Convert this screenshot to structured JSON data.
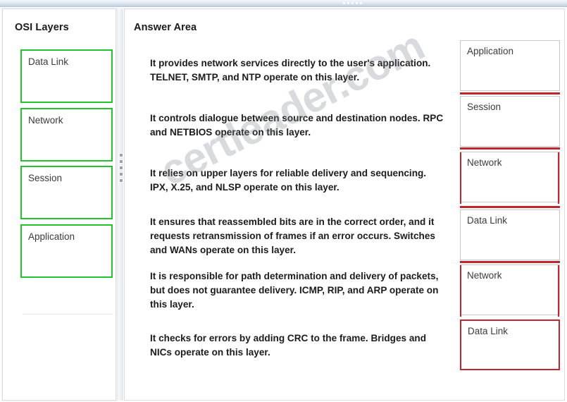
{
  "window": {
    "splitter_handle": "horizontal-splitter-handle",
    "vertical_splitter_handle": "vertical-splitter-handle"
  },
  "left_panel": {
    "title": "OSI Layers",
    "tiles": [
      {
        "label": "Data Link"
      },
      {
        "label": "Network"
      },
      {
        "label": "Session"
      },
      {
        "label": "Application"
      }
    ]
  },
  "answer_area": {
    "title": "Answer Area",
    "statements": [
      "It provides network services directly to the user's application. TELNET, SMTP, and NTP operate on this layer.",
      "It controls dialogue between source and destination nodes. RPC and NETBIOS operate on this layer.",
      "It relies on upper layers for reliable delivery and sequencing. IPX, X.25, and NLSP operate on this layer.",
      "It ensures that reassembled bits are in the correct order, and it requests retransmission of frames if an error occurs. Switches and WANs operate on this layer.",
      "It is responsible for path determination and delivery of packets, but does not guarantee delivery. ICMP, RIP, and ARP operate on this layer.",
      "It checks for errors by adding CRC to the frame. Bridges and NICs operate on this layer."
    ],
    "drop_slots": [
      {
        "label": "Application"
      },
      {
        "label": "Session"
      },
      {
        "label": "Network"
      },
      {
        "label": "Data Link"
      },
      {
        "label": "Network"
      },
      {
        "label": "Data Link"
      }
    ]
  },
  "watermark": {
    "text": "certleader.com"
  },
  "colors": {
    "source_tile_border": "#22c32e",
    "slot_accent": "#c0262b",
    "slot_border": "#c9c9c9",
    "splitter": "#ccd9e7"
  }
}
